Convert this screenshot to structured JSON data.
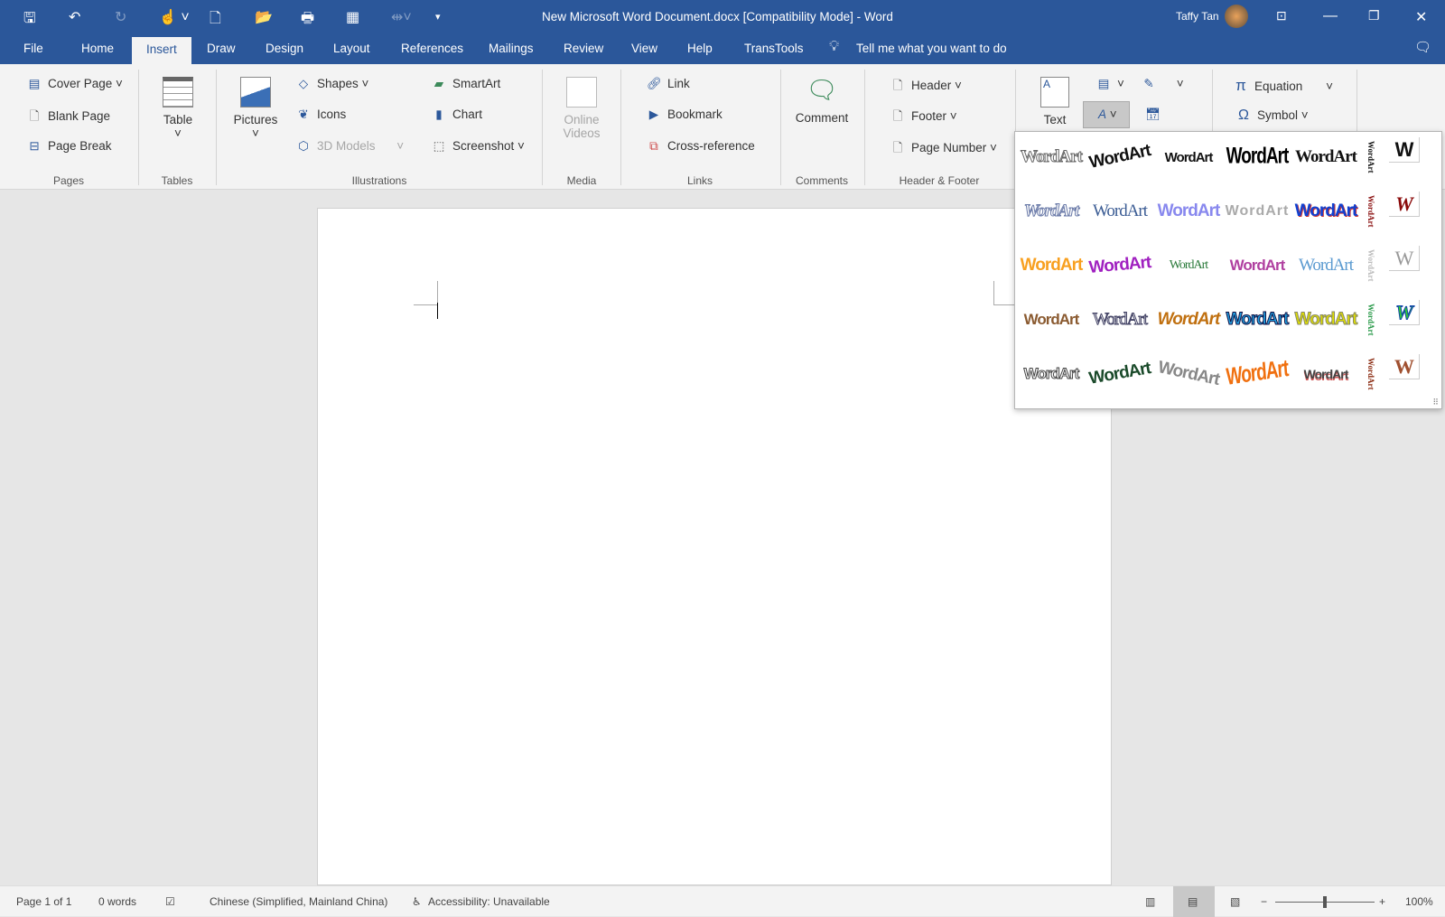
{
  "titlebar": {
    "title": "New Microsoft Word Document.docx [Compatibility Mode]  -  Word",
    "user": "Taffy Tan",
    "quick_access": [
      "save-icon",
      "undo-icon",
      "redo-icon",
      "touch-mode-icon",
      "new-icon",
      "open-icon",
      "print-preview-icon",
      "draw-table-icon",
      "customize-icon"
    ]
  },
  "tabs": [
    "File",
    "Home",
    "Insert",
    "Draw",
    "Design",
    "Layout",
    "References",
    "Mailings",
    "Review",
    "View",
    "Help",
    "TransTools"
  ],
  "active_tab": "Insert",
  "tell_me": "Tell me what you want to do",
  "ribbon": {
    "pages": {
      "label": "Pages",
      "items": [
        "Cover Page",
        "Blank Page",
        "Page Break"
      ]
    },
    "tables": {
      "label": "Tables",
      "table": "Table"
    },
    "illustrations": {
      "label": "Illustrations",
      "pictures": "Pictures",
      "shapes": "Shapes",
      "icons": "Icons",
      "models": "3D Models",
      "smartart": "SmartArt",
      "chart": "Chart",
      "screenshot": "Screenshot"
    },
    "media": {
      "label": "Media",
      "online_videos": "Online Videos"
    },
    "links": {
      "label": "Links",
      "items": [
        "Link",
        "Bookmark",
        "Cross-reference"
      ]
    },
    "comments": {
      "label": "Comments",
      "comment": "Comment"
    },
    "header_footer": {
      "label": "Header & Footer",
      "items": [
        "Header",
        "Footer",
        "Page Number"
      ]
    },
    "text": {
      "text_box": "Text"
    },
    "symbols": {
      "equation": "Equation",
      "symbol": "Symbol"
    }
  },
  "wordart_gallery": {
    "sample": "WordArt",
    "vertical_sample": "WordArt",
    "short_sample": "W"
  },
  "status": {
    "page": "Page 1 of 1",
    "words": "0 words",
    "language": "Chinese (Simplified, Mainland China)",
    "accessibility": "Accessibility: Unavailable",
    "zoom": "100%",
    "zoom_level_percent": 100
  }
}
